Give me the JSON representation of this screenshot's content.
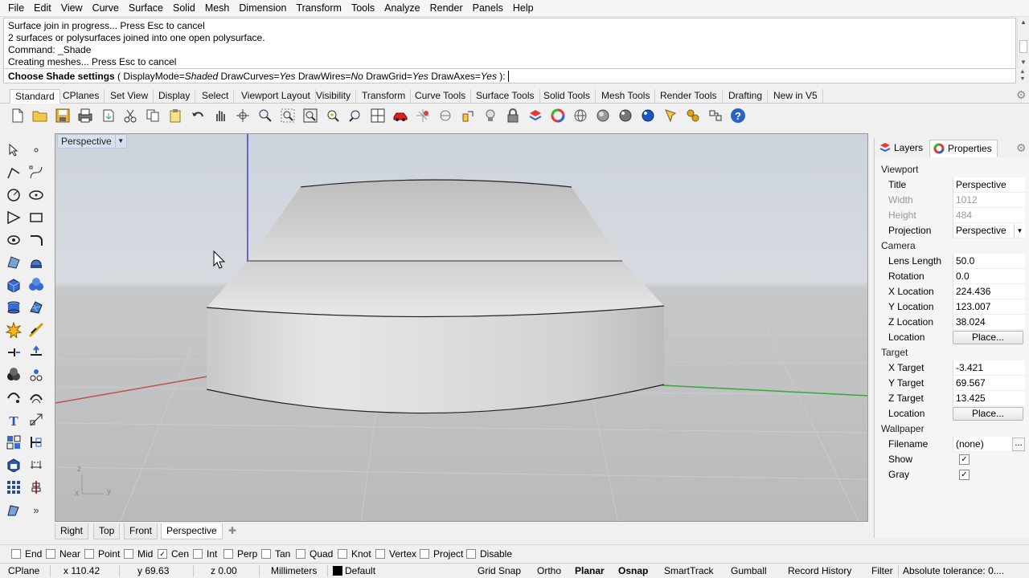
{
  "menu": [
    "File",
    "Edit",
    "View",
    "Curve",
    "Surface",
    "Solid",
    "Mesh",
    "Dimension",
    "Transform",
    "Tools",
    "Analyze",
    "Render",
    "Panels",
    "Help"
  ],
  "history": [
    "Surface join in progress... Press Esc to cancel",
    "2 surfaces or polysurfaces joined into one open polysurface.",
    "Command: _Shade",
    "Creating meshes... Press Esc to cancel"
  ],
  "command": {
    "prompt": "Choose Shade settings",
    "open": " ( ",
    "opt1_key": "DisplayMode=",
    "opt1_val": "Shaded",
    "opt2_key": " DrawCurves=",
    "opt2_val": "Yes",
    "opt3_key": " DrawWires=",
    "opt3_val": "No",
    "opt4_key": " DrawGrid=",
    "opt4_val": "Yes",
    "opt5_key": " DrawAxes=",
    "opt5_val": "Yes",
    "close": " ): "
  },
  "toolbar_tabs": [
    "Standard",
    "CPlanes",
    "Set View",
    "Display",
    "Select",
    "Viewport Layout",
    "Visibility",
    "Transform",
    "Curve Tools",
    "Surface Tools",
    "Solid Tools",
    "Mesh Tools",
    "Render Tools",
    "Drafting",
    "New in V5"
  ],
  "toolbar_icons": [
    "new-file-icon",
    "open-folder-icon",
    "save-icon",
    "print-icon",
    "import-icon",
    "cut-icon",
    "copy-icon",
    "paste-icon",
    "undo-icon",
    "pan-icon",
    "rotate-icon",
    "zoom-icon",
    "zoom-window-icon",
    "zoom-extents-icon",
    "zoom-selected-icon",
    "zoom-dynamic-icon",
    "four-viewports-icon",
    "car-icon",
    "grid-icon",
    "cplane-icon",
    "osnap-icon",
    "lock-icon",
    "lightbulb-icon",
    "layer-icon",
    "color-wheel-icon",
    "wireframe-sphere-icon",
    "shaded-sphere-icon",
    "rendered-sphere-icon",
    "blue-sphere-icon",
    "marker-icon",
    "settings-gear-icon",
    "options-icon",
    "help-icon"
  ],
  "left_tools": [
    "select-arrow-icon",
    "point-icon",
    "polyline-icon",
    "curve-icon",
    "circle-icon",
    "ellipse-icon",
    "arc-icon",
    "rectangle-icon",
    "polygon-icon",
    "fillet-icon",
    "surface-icon",
    "extrude-icon",
    "box-icon",
    "sphere-icon",
    "cylinder-icon",
    "patch-icon",
    "explode-icon",
    "trim-icon",
    "move-icon",
    "mirror-icon",
    "boolean-icon",
    "array-icon",
    "curve-network-icon",
    "offset-icon",
    "text-icon",
    "dimension-icon",
    "grid-array-icon",
    "scale-icon",
    "block-icon",
    "measure-icon",
    "matrix-icon",
    "align-icon",
    "curve-pen-icon",
    "more-icon"
  ],
  "viewport": {
    "title": "Perspective",
    "axis_z": "z",
    "axis_y": "y",
    "axis_x": "x",
    "colors": {
      "x_axis": "#c0504d",
      "y_axis": "#3aa83a",
      "z_axis": "#4040c8",
      "object": "#d8d8d8"
    }
  },
  "view_tabs": [
    "Right",
    "Top",
    "Front",
    "Perspective"
  ],
  "panel": {
    "tabs": [
      "Layers",
      "Properties"
    ],
    "sections": {
      "viewport": "Viewport",
      "camera": "Camera",
      "target": "Target",
      "wallpaper": "Wallpaper"
    },
    "viewport_rows": [
      {
        "label": "Title",
        "value": "Perspective"
      },
      {
        "label": "Width",
        "value": "1012"
      },
      {
        "label": "Height",
        "value": "484"
      },
      {
        "label": "Projection",
        "value": "Perspective"
      }
    ],
    "camera_rows": [
      {
        "label": "Lens Length",
        "value": "50.0"
      },
      {
        "label": "Rotation",
        "value": "0.0"
      },
      {
        "label": "X Location",
        "value": "224.436"
      },
      {
        "label": "Y Location",
        "value": "123.007"
      },
      {
        "label": "Z Location",
        "value": "38.024"
      },
      {
        "label": "Location",
        "value": "Place..."
      }
    ],
    "target_rows": [
      {
        "label": "X Target",
        "value": "-3.421"
      },
      {
        "label": "Y Target",
        "value": "69.567"
      },
      {
        "label": "Z Target",
        "value": "13.425"
      },
      {
        "label": "Location",
        "value": "Place..."
      }
    ],
    "wallpaper_rows": [
      {
        "label": "Filename",
        "value": "(none)"
      },
      {
        "label": "Show",
        "value": "✓"
      },
      {
        "label": "Gray",
        "value": "✓"
      }
    ],
    "dots": "..."
  },
  "osnaps": [
    {
      "label": "End",
      "checked": false
    },
    {
      "label": "Near",
      "checked": false
    },
    {
      "label": "Point",
      "checked": false
    },
    {
      "label": "Mid",
      "checked": false
    },
    {
      "label": "Cen",
      "checked": true
    },
    {
      "label": "Int",
      "checked": false
    },
    {
      "label": "Perp",
      "checked": false
    },
    {
      "label": "Tan",
      "checked": false
    },
    {
      "label": "Quad",
      "checked": false
    },
    {
      "label": "Knot",
      "checked": false
    },
    {
      "label": "Vertex",
      "checked": false
    },
    {
      "label": "Project",
      "checked": false
    },
    {
      "label": "Disable",
      "checked": false
    }
  ],
  "status": {
    "cplane": "CPlane",
    "x": "x 110.42",
    "y": "y 69.63",
    "z": "z 0.00",
    "units": "Millimeters",
    "layer": "Default",
    "grid_snap": "Grid Snap",
    "ortho": "Ortho",
    "planar": "Planar",
    "osnap": "Osnap",
    "smarttrack": "SmartTrack",
    "gumball": "Gumball",
    "record_history": "Record History",
    "filter": "Filter",
    "tolerance": "Absolute tolerance: 0...."
  }
}
